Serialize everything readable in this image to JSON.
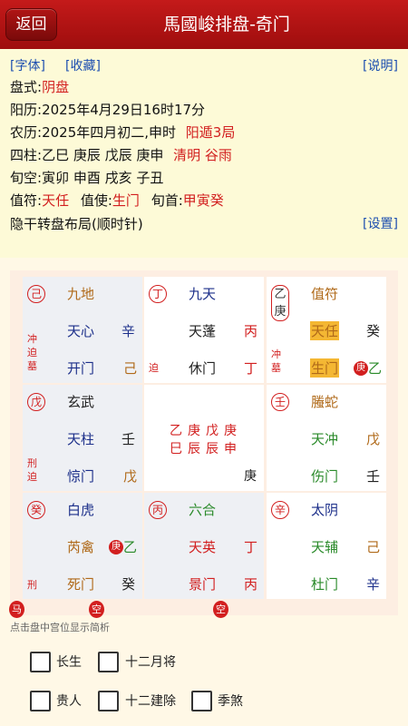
{
  "header": {
    "back_label": "返回",
    "title": "馬國峻排盘-奇门"
  },
  "links": {
    "font": "[字体]",
    "favorite": "[收藏]",
    "help": "[说明]",
    "settings": "[设置]"
  },
  "info": {
    "panshi_label": "盘式:",
    "panshi_value": "阴盘",
    "solar_label": "阳历:",
    "solar_value": "2025年4月29日16时17分",
    "lunar_label": "农历:",
    "lunar_value": "2025年四月初二,申时",
    "ju": "阳遁3局",
    "sizhu_label": "四柱:",
    "sizhu_value": "乙巳  庚辰  戊辰  庚申",
    "jieqi": "清明 谷雨",
    "xunkong_label": "旬空:",
    "xunkong_value": "寅卯  申酉  戌亥  子丑",
    "zhifu_label": "值符:",
    "zhifu_value": "天任",
    "zhishi_label": "值使:",
    "zhishi_value": "生门",
    "xunshou_label": "旬首:",
    "xunshou_value": "甲寅癸",
    "layout_note": "隐干转盘布局(顺时针)"
  },
  "palaces": [
    {
      "hidden": "己",
      "god": "九地",
      "star": "天心",
      "star_stem": "辛",
      "door": "开门",
      "door_stem": "己",
      "side": [
        "冲",
        "迫",
        "墓"
      ]
    },
    {
      "hidden": "丁",
      "god": "九天",
      "star": "天蓬",
      "star_stem": "丙",
      "door": "休门",
      "door_stem": "丁",
      "side": [
        "迫"
      ]
    },
    {
      "hidden_top": "乙",
      "hidden_bottom": "庚",
      "god": "值符",
      "star": "天任",
      "star_stem": "癸",
      "door": "生门",
      "door_stem": "乙",
      "door_badge": "庚",
      "side": [
        "冲",
        "墓"
      ]
    },
    {
      "hidden": "戊",
      "god": "玄武",
      "star": "天柱",
      "star_stem": "壬",
      "door": "惊门",
      "door_stem": "戊",
      "side": [
        "刑",
        "迫"
      ]
    },
    {
      "center_row1": [
        "乙",
        "庚",
        "戊",
        "庚"
      ],
      "center_row2": [
        "巳",
        "辰",
        "辰",
        "申"
      ],
      "bottom": "庚"
    },
    {
      "hidden": "壬",
      "god": "螣蛇",
      "star": "天冲",
      "star_stem": "戊",
      "door": "伤门",
      "door_stem": "壬"
    },
    {
      "hidden": "癸",
      "god": "白虎",
      "star": "芮禽",
      "star_stem": "乙",
      "star_badge": "庚",
      "door": "死门",
      "door_stem": "癸",
      "side": [
        "刑"
      ]
    },
    {
      "hidden": "丙",
      "god": "六合",
      "star": "天英",
      "star_stem": "丁",
      "door": "景门",
      "door_stem": "丙"
    },
    {
      "hidden": "辛",
      "god": "太阴",
      "star": "天辅",
      "star_stem": "己",
      "door": "杜门",
      "door_stem": "辛"
    }
  ],
  "markers": {
    "horse": "马",
    "void1": "空",
    "void2": "空"
  },
  "hint": "点击盘中宫位显示简析",
  "options": {
    "changsheng": "长生",
    "yuejiang": "十二月将",
    "guiren": "贵人",
    "jianchu": "十二建除",
    "jisha": "季煞"
  }
}
